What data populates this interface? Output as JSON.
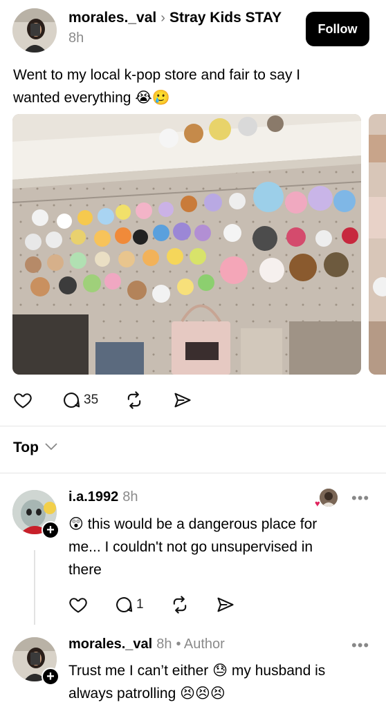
{
  "post": {
    "author": "morales._val",
    "community": "Stray Kids STAY",
    "time": "8h",
    "follow_label": "Follow",
    "text_line1": "Went to my local k-pop store and fair to say I",
    "text_line2": "wanted everything",
    "text_emoji": "😭🥲",
    "actions": {
      "like_count": "",
      "comment_count": "35",
      "repost_count": "",
      "share_count": ""
    }
  },
  "sort": {
    "label": "Top"
  },
  "comments": [
    {
      "username": "i.a.1992",
      "time": "8h",
      "emoji": "😲",
      "text_line1": "this would be a dangerous place for",
      "text_line2": "me... I couldn't not go unsupervised in",
      "text_line3": "there",
      "reply_count": "1",
      "more": "•••"
    },
    {
      "username": "morales._val",
      "time": "8h",
      "badge": "• Author",
      "text_line1a": "Trust me I can’t either",
      "emoji1": "😓",
      "text_line1b": "my husband is",
      "text_line2": "always patrolling",
      "emoji2": "😣😣😣",
      "more": "•••"
    }
  ],
  "colors": {
    "text": "#000000",
    "secondary": "#8a8a8a",
    "follow_bg": "#000000",
    "heart_red": "#e0245e"
  },
  "icons": [
    "heart-icon",
    "comment-icon",
    "repost-icon",
    "share-icon",
    "chevron-down-icon",
    "more-icon",
    "plus-icon"
  ]
}
